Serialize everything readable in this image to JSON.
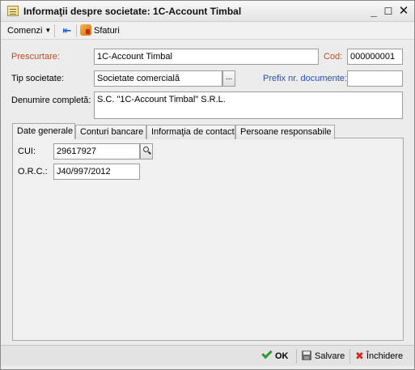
{
  "window": {
    "title": "Informaţii despre societate: 1C-Account Timbal",
    "controls": {
      "minimize": "_",
      "maximize": "☐",
      "close": "✕"
    }
  },
  "toolbar": {
    "comenzi_label": "Comenzi",
    "sfaturi_label": "Sfaturi"
  },
  "form": {
    "prescurtare_label": "Prescurtare:",
    "prescurtare_value": "1C-Account Timbal",
    "cod_label": "Cod:",
    "cod_value": "000000001",
    "tip_label": "Tip societate:",
    "tip_value": "Societate comercială",
    "tip_button": "...",
    "prefix_label": "Prefix nr. documente:",
    "prefix_value": "",
    "denumire_label": "Denumire completă:",
    "denumire_value": "S.C. \"1C-Account Timbal\" S.R.L."
  },
  "tabs": [
    {
      "label": "Date generale",
      "active": true
    },
    {
      "label": "Conturi bancare",
      "active": false
    },
    {
      "label": "Informaţia de contact",
      "active": false
    },
    {
      "label": "Persoane responsabile",
      "active": false
    }
  ],
  "general": {
    "cui_label": "CUI:",
    "cui_value": "29617927",
    "orc_label": "O.R.C.:",
    "orc_value": "J40/997/2012"
  },
  "footer": {
    "ok_label": "OK",
    "save_label": "Salvare",
    "close_label": "Închidere"
  },
  "colors": {
    "required_label": "#c24a1d",
    "link_label": "#2b4fb8",
    "ok_check": "#2f9a2f",
    "close_x": "#d12a1e"
  }
}
